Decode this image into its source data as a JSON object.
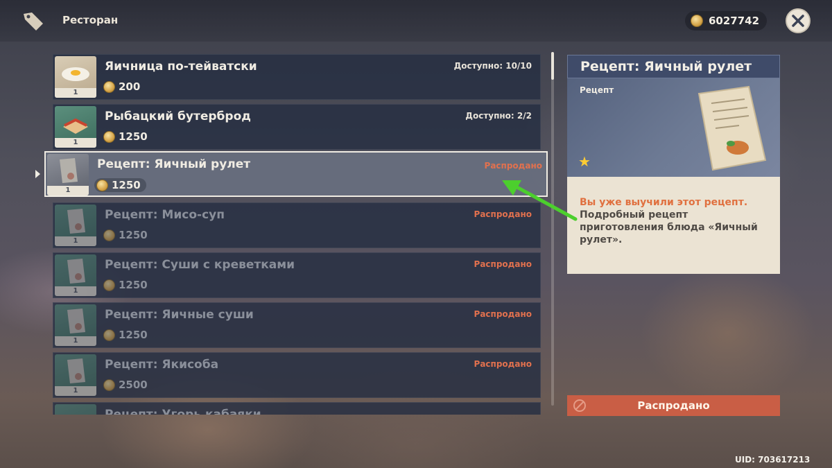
{
  "header": {
    "shop_title": "Ресторан",
    "currency_icon": "mora-coin-icon",
    "currency_amount": "6027742",
    "close_icon": "close-icon"
  },
  "items": [
    {
      "name": "Яичница по-тейватски",
      "price": "200",
      "quantity": "1",
      "status": "Доступно: 10/10",
      "thumb": "dish-eggs"
    },
    {
      "name": "Рыбацкий бутерброд",
      "price": "1250",
      "quantity": "1",
      "status": "Доступно: 2/2",
      "thumb": "dish-sandwich"
    },
    {
      "name": "Рецепт: Яичный рулет",
      "price": "1250",
      "quantity": "1",
      "status": "Распродано",
      "thumb": "recipe-scroll"
    },
    {
      "name": "Рецепт: Мисо-суп",
      "price": "1250",
      "quantity": "1",
      "status": "Распродано",
      "thumb": "recipe-scroll"
    },
    {
      "name": "Рецепт: Суши с креветками",
      "price": "1250",
      "quantity": "1",
      "status": "Распродано",
      "thumb": "recipe-scroll"
    },
    {
      "name": "Рецепт: Яичные суши",
      "price": "1250",
      "quantity": "1",
      "status": "Распродано",
      "thumb": "recipe-scroll"
    },
    {
      "name": "Рецепт: Якисоба",
      "price": "2500",
      "quantity": "1",
      "status": "Распродано",
      "thumb": "recipe-scroll"
    },
    {
      "name": "Рецепт: Угорь кабаяки",
      "price": "",
      "quantity": "",
      "status": "",
      "thumb": "recipe-scroll"
    }
  ],
  "selected_index": 2,
  "detail": {
    "title": "Рецепт: Яичный рулет",
    "type": "Рецепт",
    "rarity_stars": 1,
    "learned_text": "Вы уже выучили этот рецепт.",
    "description": "Подробный рецепт приготовления блюда «Яичный рулет».",
    "action_label": "Распродано"
  },
  "uid": "UID: 703617213",
  "colors": {
    "sold_out": "#e2714e",
    "panel_header": "#3f4b69",
    "detail_body": "#ebe3d3",
    "annotation_arrow": "#4ccf2d"
  }
}
